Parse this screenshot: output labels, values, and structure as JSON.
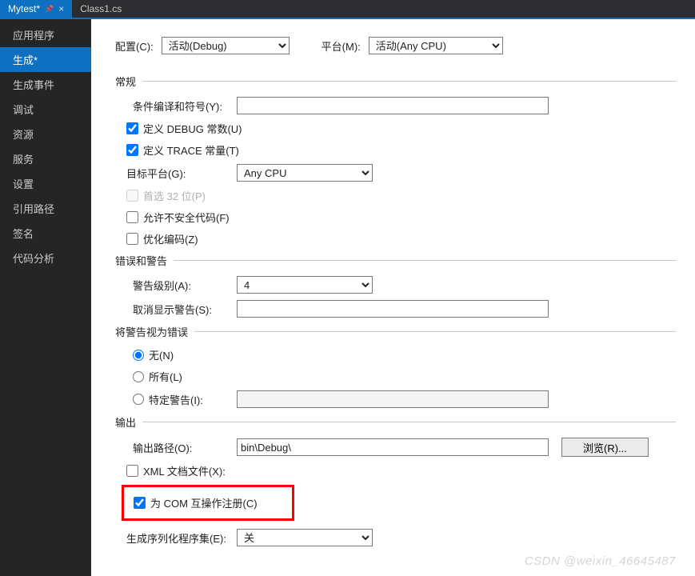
{
  "tabs": [
    {
      "label": "Mytest*",
      "active": true
    },
    {
      "label": "Class1.cs",
      "active": false
    }
  ],
  "sidebar": {
    "items": [
      "应用程序",
      "生成*",
      "生成事件",
      "调试",
      "资源",
      "服务",
      "设置",
      "引用路径",
      "签名",
      "代码分析"
    ],
    "selectedIndex": 1
  },
  "topConfig": {
    "cfgLabel": "配置(C):",
    "cfgValue": "活动(Debug)",
    "platLabel": "平台(M):",
    "platValue": "活动(Any CPU)"
  },
  "general": {
    "title": "常规",
    "conditionalLabel": "条件编译和符号(Y):",
    "conditionalValue": "",
    "debugConst": "定义 DEBUG 常数(U)",
    "traceConst": "定义 TRACE 常量(T)",
    "targetPlatformLabel": "目标平台(G):",
    "targetPlatformValue": "Any CPU",
    "prefer32": "首选 32 位(P)",
    "allowUnsafe": "允许不安全代码(F)",
    "optimize": "优化编码(Z)"
  },
  "warnings": {
    "title": "错误和警告",
    "levelLabel": "警告级别(A):",
    "levelValue": "4",
    "suppressLabel": "取消显示警告(S):",
    "suppressValue": ""
  },
  "treatAsError": {
    "title": "将警告视为错误",
    "none": "无(N)",
    "all": "所有(L)",
    "specific": "特定警告(I):",
    "specificValue": ""
  },
  "output": {
    "title": "输出",
    "pathLabel": "输出路径(O):",
    "pathValue": "bin\\Debug\\",
    "browse": "浏览(R)...",
    "xmlDoc": "XML 文档文件(X):",
    "comInterop": "为 COM 互操作注册(C)",
    "serializationLabel": "生成序列化程序集(E):",
    "serializationValue": "关"
  },
  "watermark": "CSDN @weixin_46645487"
}
